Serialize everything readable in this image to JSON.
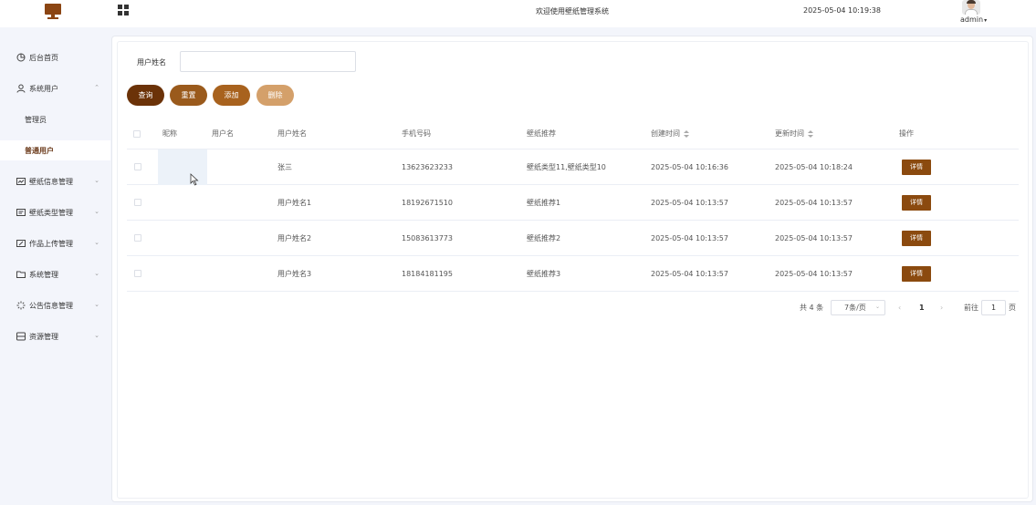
{
  "header": {
    "title": "欢迎使用壁纸管理系统",
    "datetime": "2025-05-04 10:19:38",
    "user": "admin"
  },
  "sidebar": {
    "items": [
      {
        "label": "后台首页",
        "icon": "pie-chart-icon"
      },
      {
        "label": "系统用户",
        "icon": "user-icon",
        "expanded": true
      },
      {
        "label": "壁纸信息管理",
        "icon": "chart-card-icon"
      },
      {
        "label": "壁纸类型管理",
        "icon": "list-card-icon"
      },
      {
        "label": "作品上传管理",
        "icon": "edit-card-icon"
      },
      {
        "label": "系统管理",
        "icon": "folder-icon"
      },
      {
        "label": "公告信息管理",
        "icon": "loading-icon"
      },
      {
        "label": "资源管理",
        "icon": "database-icon"
      }
    ],
    "sub_items": [
      {
        "label": "管理员",
        "active": false
      },
      {
        "label": "普通用户",
        "active": true
      }
    ]
  },
  "search": {
    "label": "用户姓名",
    "value": "",
    "placeholder": ""
  },
  "buttons": {
    "query": "查询",
    "reset": "重置",
    "add": "添加",
    "delete": "删除"
  },
  "colors": {
    "query": "#6b3208",
    "reset": "#9a5a1c",
    "add": "#a8621e",
    "delete": "#d4a06a",
    "detail": "#8b4a0f",
    "active_menu": "#6b3a1a"
  },
  "table": {
    "columns": [
      "昵称",
      "用户名",
      "用户姓名",
      "手机号码",
      "壁纸推荐",
      "创建时间",
      "更新时间",
      "操作"
    ],
    "rows": [
      {
        "nickname": "",
        "username": "",
        "realname": "张三",
        "phone": "13623623233",
        "recommend": "壁纸类型11,壁纸类型10",
        "created": "2025-05-04 10:16:36",
        "updated": "2025-05-04 10:18:24",
        "action": "详情"
      },
      {
        "nickname": "",
        "username": "",
        "realname": "用户姓名1",
        "phone": "18192671510",
        "recommend": "壁纸推荐1",
        "created": "2025-05-04 10:13:57",
        "updated": "2025-05-04 10:13:57",
        "action": "详情"
      },
      {
        "nickname": "",
        "username": "",
        "realname": "用户姓名2",
        "phone": "15083613773",
        "recommend": "壁纸推荐2",
        "created": "2025-05-04 10:13:57",
        "updated": "2025-05-04 10:13:57",
        "action": "详情"
      },
      {
        "nickname": "",
        "username": "",
        "realname": "用户姓名3",
        "phone": "18184181195",
        "recommend": "壁纸推荐3",
        "created": "2025-05-04 10:13:57",
        "updated": "2025-05-04 10:13:57",
        "action": "详情"
      }
    ]
  },
  "pagination": {
    "total": "共 4 条",
    "page_size": "7条/页",
    "prev": "‹",
    "current": "1",
    "next": "›",
    "goto_label": "前往",
    "goto_value": "1",
    "page_unit": "页"
  }
}
